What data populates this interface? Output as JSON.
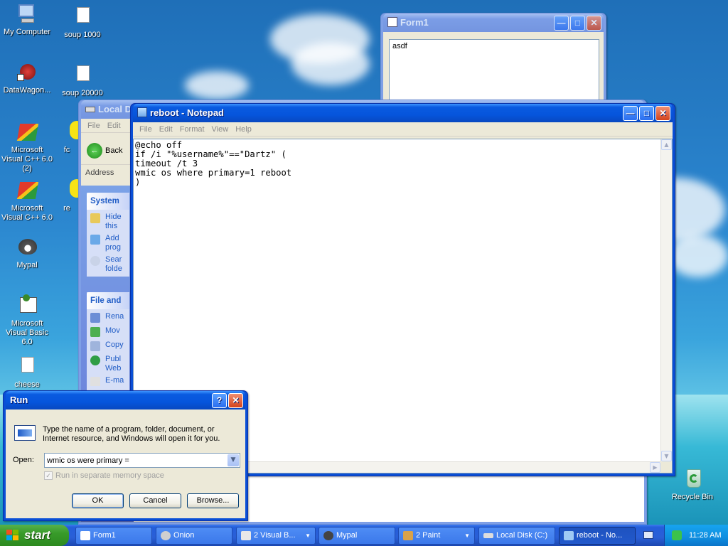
{
  "desktop": {
    "icons": [
      {
        "label": "My Computer",
        "icon": "my-computer-icon"
      },
      {
        "label": "soup 1000",
        "icon": "file-icon"
      },
      {
        "label": "DataWagon...",
        "icon": "datawagon-shortcut-icon"
      },
      {
        "label": "soup 20000",
        "icon": "file-icon"
      },
      {
        "label": "Microsoft Visual C++ 6.0 (2)",
        "icon": "visual-cpp-icon"
      },
      {
        "label": "fc",
        "icon": "shortcut-icon"
      },
      {
        "label": "Microsoft Visual C++ 6.0",
        "icon": "visual-cpp-icon"
      },
      {
        "label": "re",
        "icon": "shortcut-icon"
      },
      {
        "label": "Mypal",
        "icon": "mypal-icon"
      },
      {
        "label": "Microsoft Visual Basic 6.0",
        "icon": "visual-basic-icon"
      },
      {
        "label": "cheese",
        "icon": "file-icon"
      },
      {
        "label": "Recycle Bin",
        "icon": "recycle-bin-icon"
      }
    ]
  },
  "form1": {
    "title": "Form1",
    "textbox": "asdf"
  },
  "explorer": {
    "title": "Local Di",
    "menu": [
      "File",
      "Edit"
    ],
    "back_label": "Back",
    "address_label": "Address",
    "system_tasks": {
      "header": "System",
      "links": [
        {
          "label": "Hide this",
          "icon": "hide-icon"
        },
        {
          "label": "Add prog",
          "icon": "add-icon"
        },
        {
          "label": "Sear folde",
          "icon": "search-icon"
        }
      ]
    },
    "file_tasks": {
      "header": "File and",
      "links": [
        {
          "label": "Rena",
          "icon": "rename-icon"
        },
        {
          "label": "Mov",
          "icon": "move-icon"
        },
        {
          "label": "Copy",
          "icon": "copy-icon"
        },
        {
          "label": "Publ Web",
          "icon": "publish-icon"
        },
        {
          "label": "E-ma",
          "icon": "email-icon"
        }
      ]
    }
  },
  "notepad": {
    "title": "reboot - Notepad",
    "menu": [
      "File",
      "Edit",
      "Format",
      "View",
      "Help"
    ],
    "content": "@echo off\nif /i \"%username%\"==\"Dartz\" (\ntimeout /t 3\nwmic os where primary=1 reboot\n)"
  },
  "run_dialog": {
    "title": "Run",
    "description": "Type the name of a program, folder, document, or Internet resource, and Windows will open it for you.",
    "open_label": "Open:",
    "open_value": "wmic os were primary =",
    "checkbox_label": "Run in separate memory space",
    "checkbox_checked": true,
    "ok_label": "OK",
    "cancel_label": "Cancel",
    "browse_label": "Browse...",
    "help_label": "?",
    "close_label": "✕"
  },
  "taskbar": {
    "start_label": "start",
    "items": [
      {
        "label": "Form1",
        "icon": "form-icon",
        "active": false,
        "group": false
      },
      {
        "label": "Onion",
        "icon": "onion-icon",
        "active": false,
        "group": false
      },
      {
        "label": "2 Visual B...",
        "icon": "visual-basic-icon",
        "active": false,
        "group": true
      },
      {
        "label": "Mypal",
        "icon": "mypal-icon",
        "active": false,
        "group": false
      },
      {
        "label": "2 Paint",
        "icon": "paint-icon",
        "active": false,
        "group": true
      },
      {
        "label": "Local Disk (C:)",
        "icon": "drive-icon",
        "active": false,
        "group": false
      },
      {
        "label": "reboot - No...",
        "icon": "notepad-icon",
        "active": true,
        "group": false
      }
    ],
    "clock": "11:28 AM"
  },
  "colors": {
    "xp_blue": "#0a5be0",
    "start_green": "#389b2a",
    "close_red": "#d4431c",
    "link_blue": "#215dc6"
  }
}
